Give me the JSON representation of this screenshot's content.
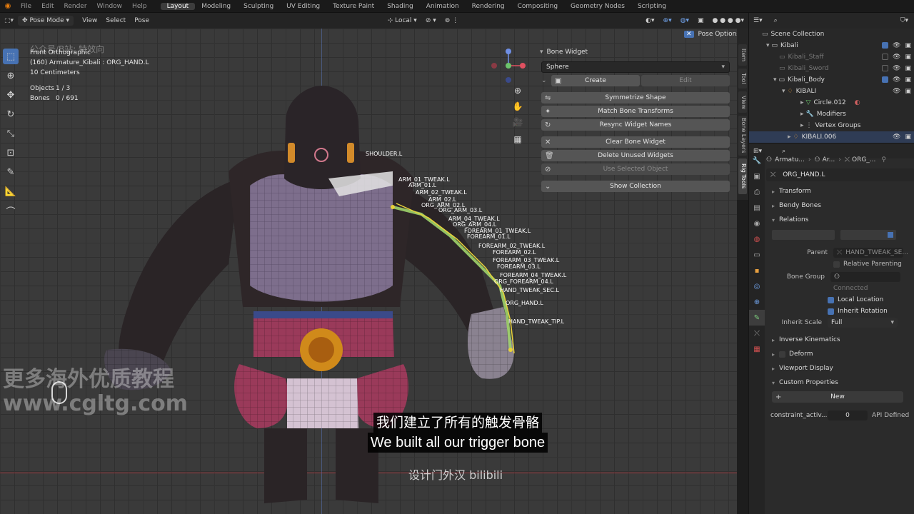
{
  "topbar": {
    "menus": [
      "File",
      "Edit",
      "Render",
      "Window",
      "Help"
    ],
    "workspaces": [
      "Layout",
      "Modeling",
      "Sculpting",
      "UV Editing",
      "Texture Paint",
      "Shading",
      "Animation",
      "Rendering",
      "Compositing",
      "Geometry Nodes",
      "Scripting"
    ],
    "active_workspace": "Layout"
  },
  "viewport_header": {
    "mode": "Pose Mode",
    "view": "View",
    "select": "Select",
    "pose": "Pose",
    "orientation": "Local",
    "pose_options": "Pose Options"
  },
  "viewport_info": {
    "view_name": "Front Orthographic",
    "active": "(160) Armature_Kibali : ORG_HAND.L",
    "scale": "10 Centimeters",
    "objects_label": "Objects",
    "objects_value": "1 / 3",
    "bones_label": "Bones",
    "bones_value": "0 / 691"
  },
  "bone_labels": [
    "SHOULDER.L",
    "ARM_01_TWEAK.L",
    "ARM_01.L",
    "ARM_02_TWEAK.L",
    "ARM_02.L",
    "ORG_ARM_02.L",
    "ORG_ARM_03.L",
    "ARM_04_TWEAK.L",
    "ORG_ARM_04.L",
    "FOREARM_01_TWEAK.L",
    "FOREARM_01.L",
    "FOREARM_02_TWEAK.L",
    "FOREARM_02.L",
    "FOREARM_03_TWEAK.L",
    "FOREARM_03.L",
    "FOREARM_04_TWEAK.L",
    "ORG_FOREARM_04.L",
    "HAND_TWEAK_SEC.L",
    "ORG_HAND.L",
    "HAND_TWEAK_TIP.L"
  ],
  "bone_widget": {
    "title": "Bone Widget",
    "shape": "Sphere",
    "create": "Create",
    "edit": "Edit",
    "symmetrize": "Symmetrize Shape",
    "match": "Match Bone Transforms",
    "resync": "Resync Widget Names",
    "clear": "Clear Bone Widget",
    "delete_unused": "Delete Unused Widgets",
    "use_selected": "Use Selected Object",
    "show_collection": "Show Collection"
  },
  "side_tabs": [
    "Item",
    "Tool",
    "View",
    "Bone Layers",
    "Rig Tools"
  ],
  "outliner": {
    "items": [
      {
        "label": "Scene Collection",
        "depth": 0,
        "dim": false,
        "check": null
      },
      {
        "label": "Kibali",
        "depth": 1,
        "dim": false,
        "check": true
      },
      {
        "label": "Kibali_Staff",
        "depth": 2,
        "dim": true,
        "check": false
      },
      {
        "label": "Kibali_Sword",
        "depth": 2,
        "dim": true,
        "check": false
      },
      {
        "label": "Kibali_Body",
        "depth": 2,
        "dim": false,
        "check": true
      },
      {
        "label": "KIBALI",
        "depth": 3,
        "dim": false,
        "check": null
      },
      {
        "label": "Circle.012",
        "depth": 4,
        "dim": false,
        "check": null
      },
      {
        "label": "Modifiers",
        "depth": 4,
        "dim": false,
        "check": null
      },
      {
        "label": "Vertex Groups",
        "depth": 4,
        "dim": false,
        "check": null
      },
      {
        "label": "KIBALI.006",
        "depth": 3,
        "dim": false,
        "check": null
      }
    ]
  },
  "properties": {
    "breadcrumb": [
      "Armatu...",
      "Ar...",
      "ORG_..."
    ],
    "bone_name": "ORG_HAND.L",
    "transform": "Transform",
    "bendy_bones": "Bendy Bones",
    "relations": "Relations",
    "parent_label": "Parent",
    "parent_value": "HAND_TWEAK_SE...",
    "relative_parenting": "Relative Parenting",
    "bone_group_label": "Bone Group",
    "connected": "Connected",
    "local_location": "Local Location",
    "inherit_rotation": "Inherit Rotation",
    "inherit_scale_label": "Inherit Scale",
    "inherit_scale_value": "Full",
    "inverse_kinematics": "Inverse Kinematics",
    "deform": "Deform",
    "viewport_display": "Viewport Display",
    "custom_properties": "Custom Properties",
    "new_button": "New",
    "prop_name": "constraint_activ...",
    "prop_value": "0",
    "prop_api": "API Defined"
  },
  "watermarks": {
    "top": "公众号/B站: 特效向",
    "big_cn": "更多海外优质教程",
    "big_url": "www.cgltg.com",
    "bottom": "设计门外汉 bilibili"
  },
  "subtitle": {
    "zh": "我们建立了所有的触发骨骼",
    "en": "We built all our trigger bone"
  },
  "colors": {
    "accent": "#4772b3",
    "bone_green": "#9fd36a",
    "bone_yellow": "#e8d23a",
    "x_axis": "#c8323c"
  }
}
